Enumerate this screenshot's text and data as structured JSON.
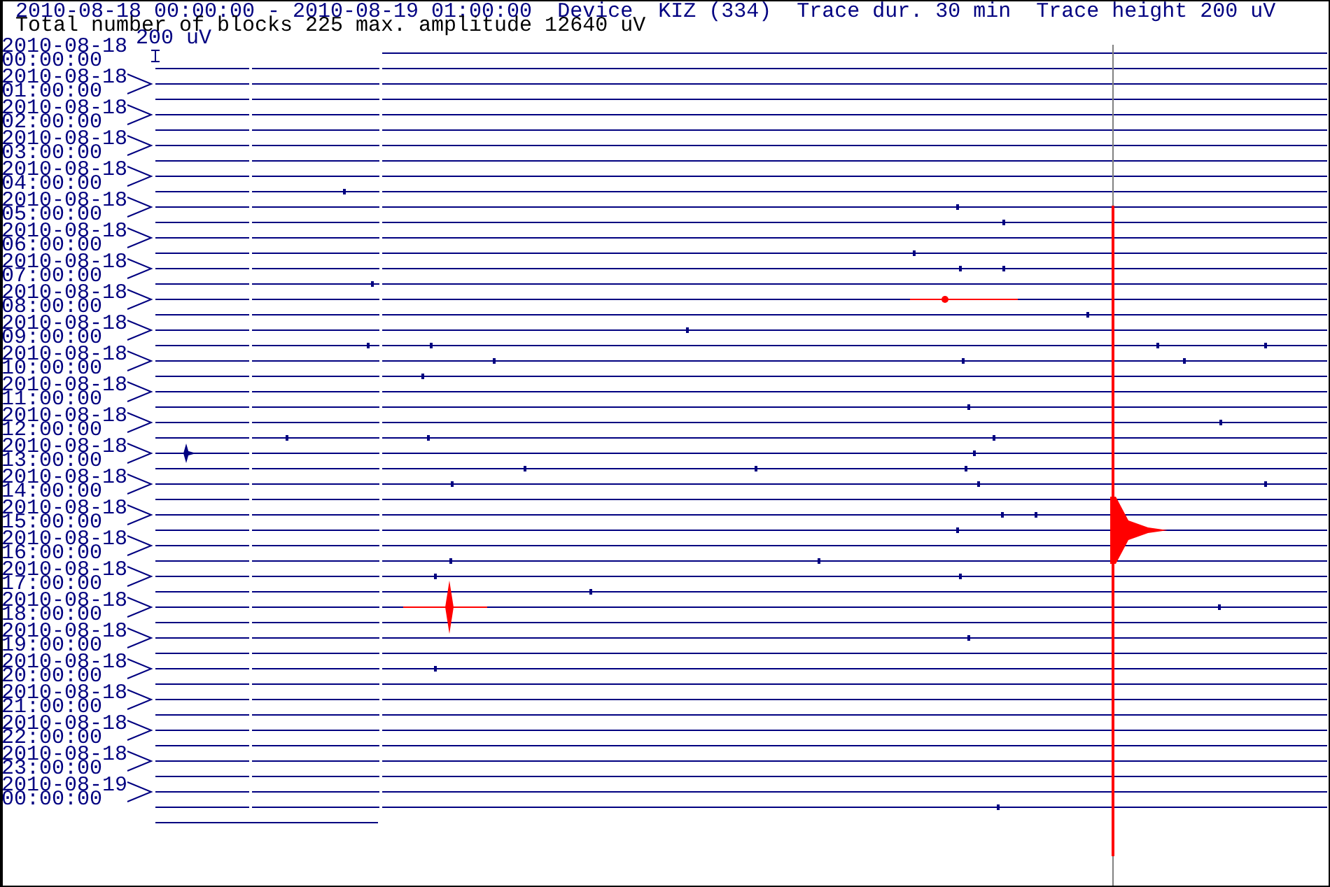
{
  "header": {
    "line_1": "2010-08-18 00:00:00 - 2010-08-19 01:00:00  Device  KIZ (334)  Trace dur. 30 min  Trace height 200 uV",
    "line_2": "Total number of blocks 225 max. amplitude 12640 uV"
  },
  "scale_label": "200 uV",
  "hours": [
    {
      "date": "2010-08-18",
      "time": "00:00:00"
    },
    {
      "date": "2010-08-18",
      "time": "01:00:00"
    },
    {
      "date": "2010-08-18",
      "time": "02:00:00"
    },
    {
      "date": "2010-08-18",
      "time": "03:00:00"
    },
    {
      "date": "2010-08-18",
      "time": "04:00:00"
    },
    {
      "date": "2010-08-18",
      "time": "05:00:00"
    },
    {
      "date": "2010-08-18",
      "time": "06:00:00"
    },
    {
      "date": "2010-08-18",
      "time": "07:00:00"
    },
    {
      "date": "2010-08-18",
      "time": "08:00:00"
    },
    {
      "date": "2010-08-18",
      "time": "09:00:00"
    },
    {
      "date": "2010-08-18",
      "time": "10:00:00"
    },
    {
      "date": "2010-08-18",
      "time": "11:00:00"
    },
    {
      "date": "2010-08-18",
      "time": "12:00:00"
    },
    {
      "date": "2010-08-18",
      "time": "13:00:00"
    },
    {
      "date": "2010-08-18",
      "time": "14:00:00"
    },
    {
      "date": "2010-08-18",
      "time": "15:00:00"
    },
    {
      "date": "2010-08-18",
      "time": "16:00:00"
    },
    {
      "date": "2010-08-18",
      "time": "17:00:00"
    },
    {
      "date": "2010-08-18",
      "time": "18:00:00"
    },
    {
      "date": "2010-08-18",
      "time": "19:00:00"
    },
    {
      "date": "2010-08-18",
      "time": "20:00:00"
    },
    {
      "date": "2010-08-18",
      "time": "21:00:00"
    },
    {
      "date": "2010-08-18",
      "time": "22:00:00"
    },
    {
      "date": "2010-08-18",
      "time": "23:00:00"
    },
    {
      "date": "2010-08-19",
      "time": "00:00:00"
    }
  ]
}
